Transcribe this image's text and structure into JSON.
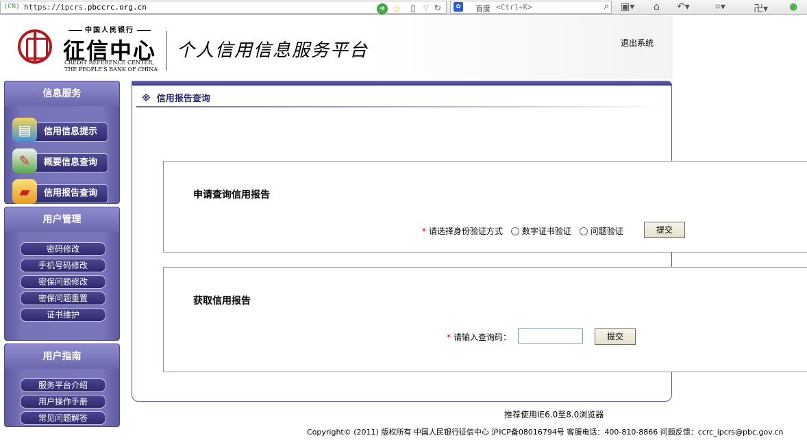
{
  "browser": {
    "cn_tag": "(CN)",
    "url_prefix": "https://ipcrs.",
    "url_domain": "pbccrc.org.cn",
    "search_engine": "百度",
    "search_placeholder": "<Ctrl+K>"
  },
  "header": {
    "logo_top": "中国人民银行",
    "logo_main": "征信中心",
    "logo_en_line1": "CREDIT REFERENCE CENTER,",
    "logo_en_line2": "THE PEOPLE'S BANK OF CHINA",
    "title": "个人信用信息服务平台",
    "logout": "退出系统"
  },
  "sidebar": {
    "info": {
      "heading": "信息服务",
      "items": [
        {
          "label": "信用信息提示",
          "icon": "credit-card-icon"
        },
        {
          "label": "概要信息查询",
          "icon": "pencil-document-icon"
        },
        {
          "label": "信用报告查询",
          "icon": "report-folder-icon"
        }
      ]
    },
    "user": {
      "heading": "用户管理",
      "items": [
        "密码修改",
        "手机号码修改",
        "密保问题修改",
        "密保问题重置",
        "证书维护"
      ]
    },
    "guide": {
      "heading": "用户指南",
      "items": [
        "服务平台介绍",
        "用户操作手册",
        "常见问题解答"
      ]
    }
  },
  "main": {
    "breadcrumb_mark": "※",
    "breadcrumb": "信用报告查询",
    "apply": {
      "title": "申请查询信用报告",
      "label": "请选择身份验证方式",
      "option1": "数字证书验证",
      "option2": "问题验证",
      "submit": "提交"
    },
    "get": {
      "title": "获取信用报告",
      "label": "请输入查询码：",
      "code_value": "",
      "submit": "提交"
    }
  },
  "footer": {
    "browser_note": "推荐使用IE6.0至8.0浏览器",
    "copyright": "Copyright© (2011) 版权所有 中国人民银行征信中心 沪ICP备08016794号 客服电话：400-810-8866 问题反馈：ccrc_ipcrs@pbc.gov.cn"
  },
  "colors": {
    "sidebar_purple": "#6e6ab0",
    "button_dark": "#2f2b6f",
    "seal_red": "#b3191e",
    "required_red": "#cc0000"
  }
}
